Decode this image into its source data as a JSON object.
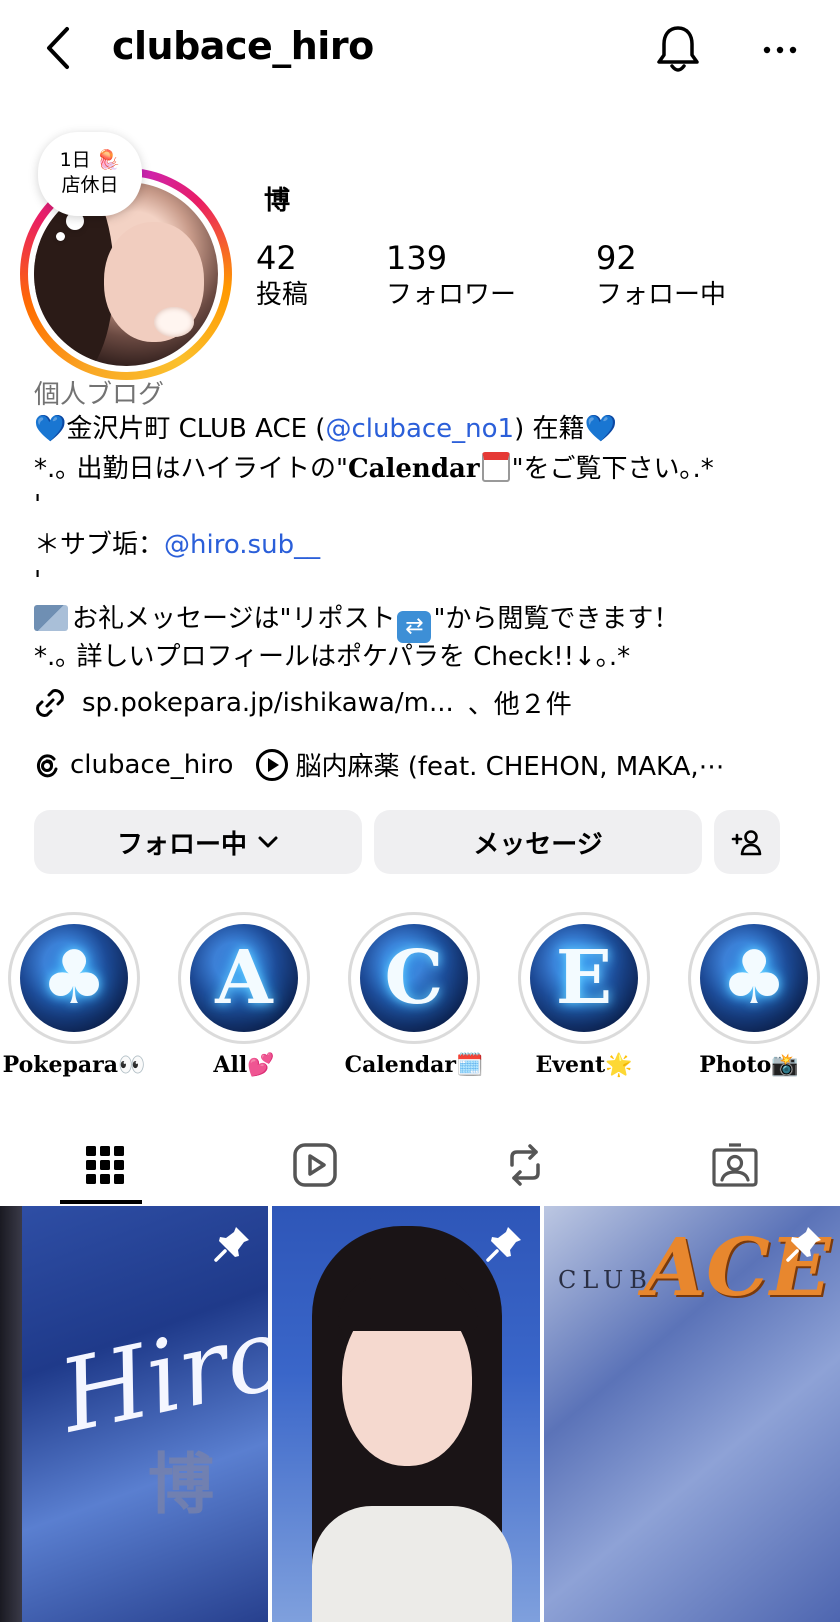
{
  "header": {
    "username": "clubace_hiro",
    "back_icon": "chevron-left-icon",
    "bell_icon": "bell-icon",
    "more_icon": "more-horizontal-icon"
  },
  "profile": {
    "note_line1": "1日 🪼",
    "note_line2": "店休日",
    "display_name": "博",
    "stats": [
      {
        "num": "42",
        "label": "投稿"
      },
      {
        "num": "139",
        "label": "フォロワー"
      },
      {
        "num": "92",
        "label": "フォロー中"
      }
    ]
  },
  "bio": {
    "category": "個人ブログ",
    "line1_pre": "金沢片町 CLUB ACE (",
    "line1_mention": "@clubace_no1",
    "line1_post": ") 在籍",
    "heart": "💙",
    "line2_pre": "*.｡ 出勤日はハイライトの\"",
    "line2_bold": "Calendar",
    "line2_post": "\"をご覧下さい｡.*",
    "quote_mark": "'",
    "line3_pre": "＊サブ垢：",
    "line3_mention": "@hiro.sub__",
    "line4_pre": "お礼メッセージは\"リポスト",
    "line4_post": "\"から閲覧できます！",
    "line5": "*.｡ 詳しいプロフィールはポケパラを Check!!↓｡.*"
  },
  "link": {
    "text": "sp.pokepara.jp/ishikawa/m...",
    "more": "、他２件"
  },
  "threads": {
    "handle": "clubace_hiro",
    "music": "脳内麻薬 (feat. CHEHON, MAKA,⋯"
  },
  "buttons": {
    "following": "フォロー中",
    "message": "メッセージ"
  },
  "highlights": [
    {
      "glyph": "♣",
      "label": "Pokepara👀"
    },
    {
      "glyph": "A",
      "label": "All💕"
    },
    {
      "glyph": "C",
      "label": "Calendar🗓️"
    },
    {
      "glyph": "E",
      "label": "Event🌟"
    },
    {
      "glyph": "♣",
      "label": "Photo📸"
    }
  ],
  "posts": [
    {
      "title": "Hiro",
      "subtitle": "博"
    },
    {
      "title": "",
      "subtitle": ""
    },
    {
      "title": "ACE",
      "subtitle": "CLUB"
    }
  ],
  "colors": {
    "mention": "#2b5fd9",
    "button_bg": "#efeff1"
  }
}
